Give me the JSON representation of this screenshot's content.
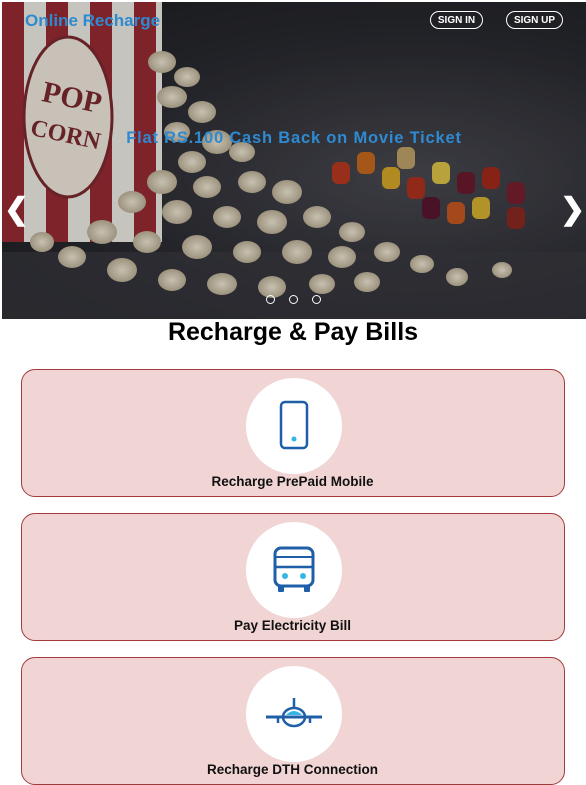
{
  "header": {
    "brand": "Online Recharge",
    "sign_in": "SIGN IN",
    "sign_up": "SIGN UP"
  },
  "carousel": {
    "caption": "Flat RS.100 Cash Back on Movie Ticket",
    "popcorn_box_text": [
      "POP",
      "CORN"
    ],
    "prev_glyph": "❮",
    "next_glyph": "❯",
    "slide_count": 3
  },
  "main": {
    "title": "Recharge & Pay Bills",
    "services": [
      {
        "label": "Recharge PrePaid Mobile",
        "icon": "mobile-phone-icon"
      },
      {
        "label": "Pay Electricity Bill",
        "icon": "bus-icon"
      },
      {
        "label": "Recharge DTH Connection",
        "icon": "airplane-icon"
      }
    ]
  },
  "colors": {
    "accent_blue": "#2e8ad1",
    "icon_blue": "#1f5fa8",
    "card_bg": "#f1d4d4",
    "card_border": "#a13b3b"
  }
}
